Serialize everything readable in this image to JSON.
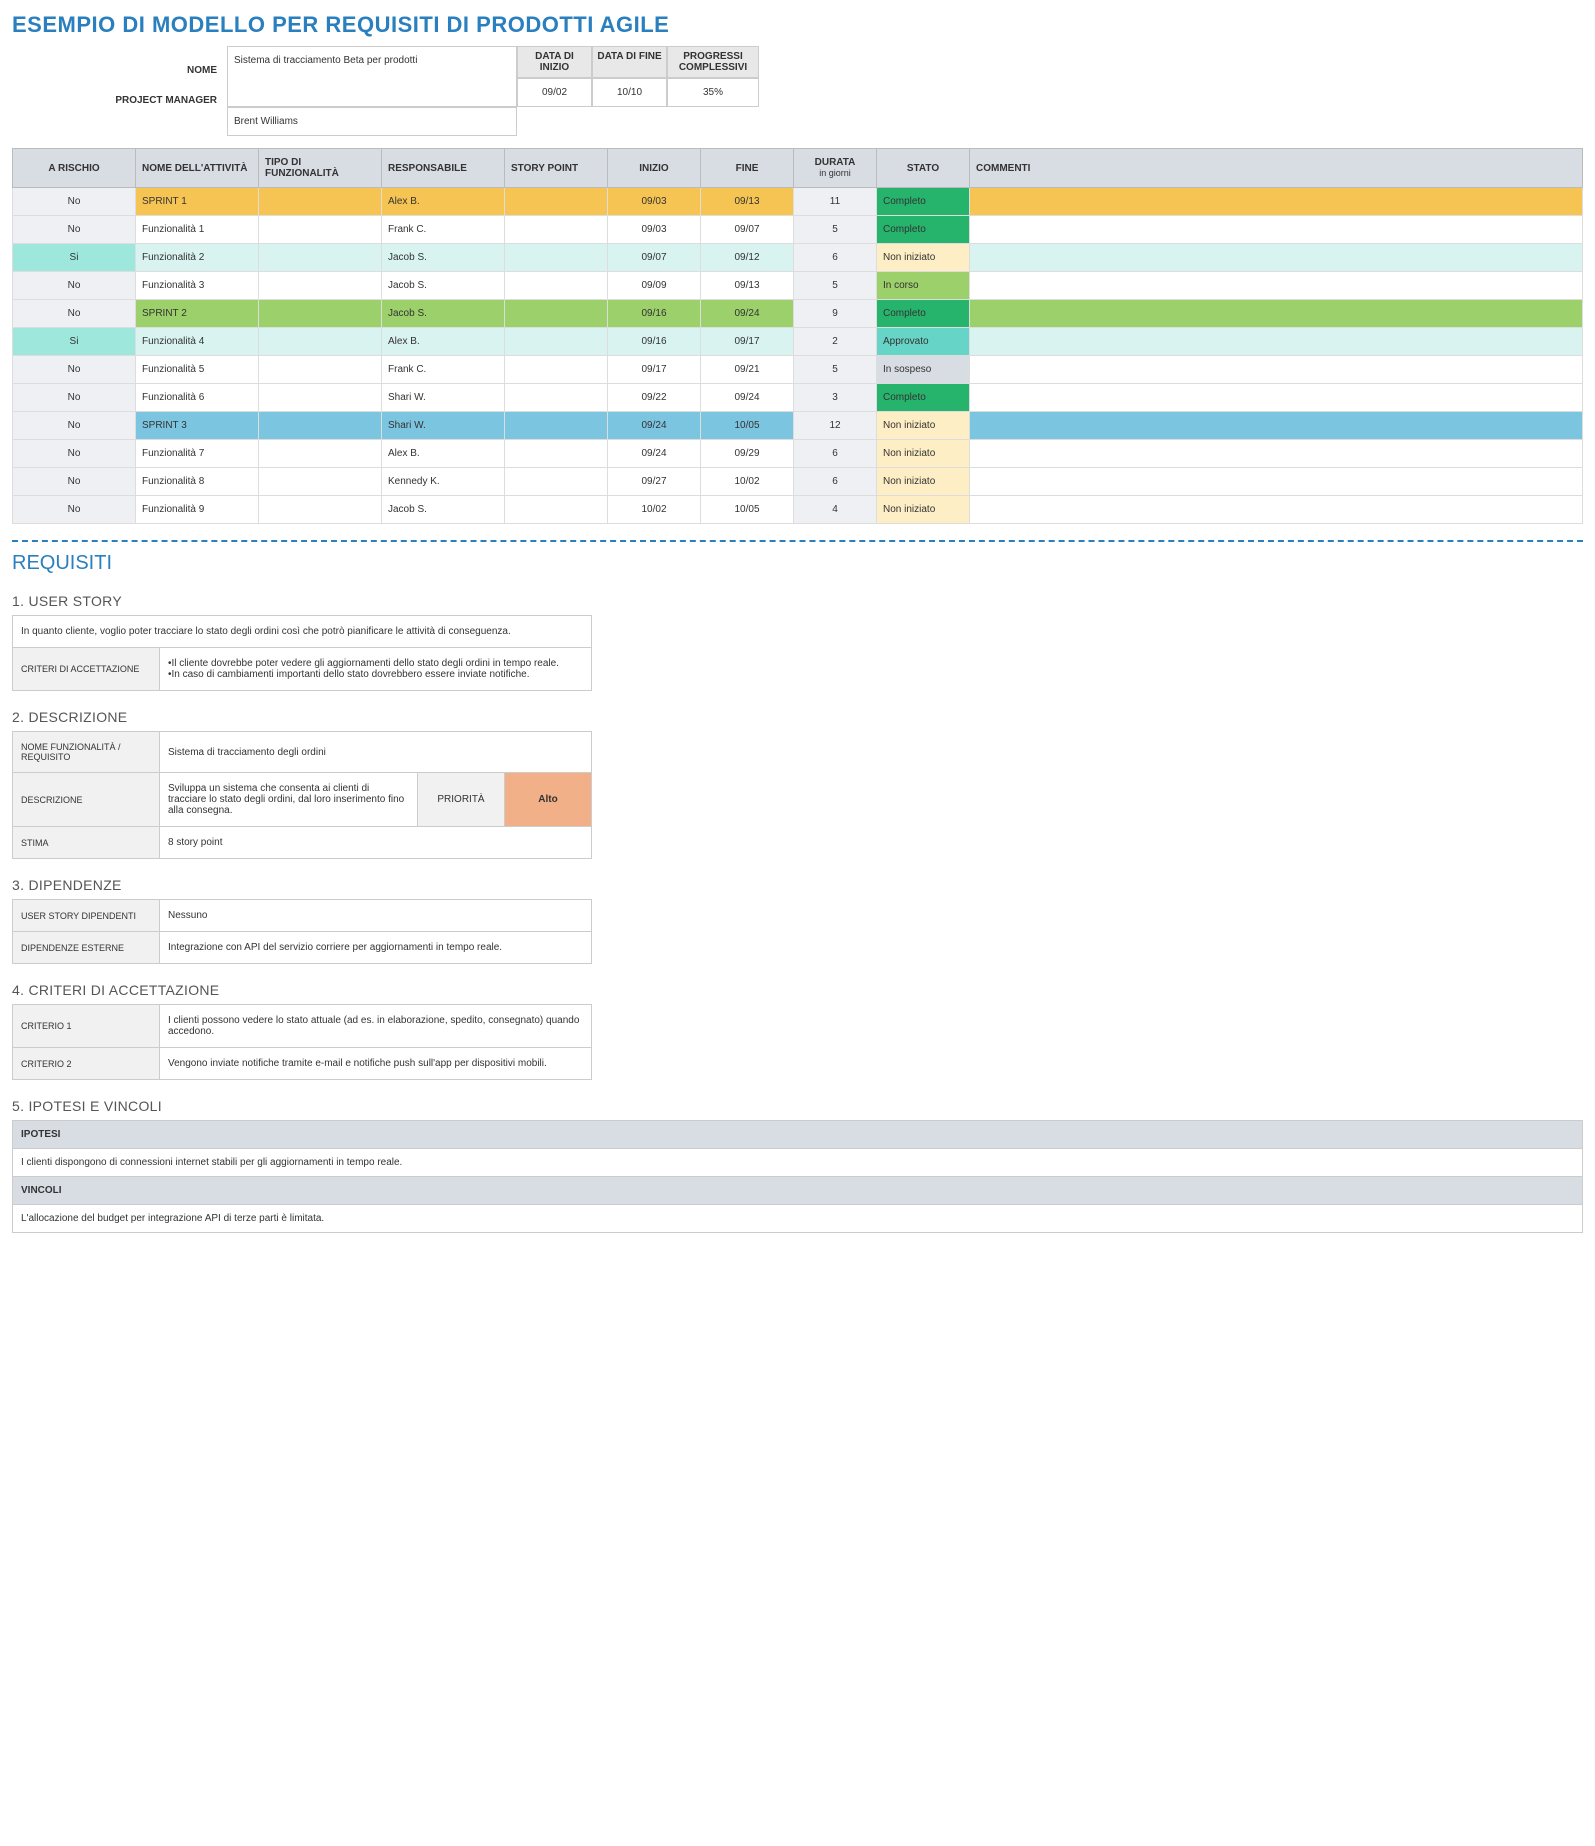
{
  "title": "ESEMPIO DI MODELLO PER REQUISITI DI PRODOTTI AGILE",
  "topLabels": {
    "nome": "NOME",
    "pm": "PROJECT MANAGER"
  },
  "topHeaders": {
    "dataInizio": "DATA DI INIZIO",
    "dataFine": "DATA DI FINE",
    "prog": "PROGRESSI COMPLESSIVI"
  },
  "project": {
    "nome": "Sistema di tracciamento Beta per prodotti",
    "pm": "Brent Williams",
    "inizio": "09/02",
    "fine": "10/10",
    "progressi": "35%"
  },
  "cols": {
    "risk": "A RISCHIO",
    "act": "NOME DELL'ATTIVITÀ",
    "type": "TIPO DI FUNZIONALITÀ",
    "resp": "RESPONSABILE",
    "sp": "STORY POINT",
    "start": "INIZIO",
    "end": "FINE",
    "dur": "DURATA",
    "durSub": "in giorni",
    "stato": "STATO",
    "comm": "COMMENTI"
  },
  "rows": [
    {
      "cls": "sprint1",
      "r": "No",
      "a": "SPRINT 1",
      "t": "",
      "resp": "Alex B.",
      "sp": "",
      "s": "09/03",
      "e": "09/13",
      "d": "11",
      "st": "Completo",
      "stc": "st-done"
    },
    {
      "cls": "",
      "r": "No",
      "a": "Funzionalità 1",
      "t": "",
      "resp": "Frank C.",
      "sp": "",
      "s": "09/03",
      "e": "09/07",
      "d": "5",
      "st": "Completo",
      "stc": "st-done"
    },
    {
      "cls": "cyan",
      "r": "Si",
      "rc": "riskcy",
      "a": "Funzionalità 2",
      "t": "",
      "resp": "Jacob S.",
      "sp": "",
      "s": "09/07",
      "e": "09/12",
      "d": "6",
      "st": "Non iniziato",
      "stc": "st-notst"
    },
    {
      "cls": "",
      "r": "No",
      "a": "Funzionalità 3",
      "t": "",
      "resp": "Jacob S.",
      "sp": "",
      "s": "09/09",
      "e": "09/13",
      "d": "5",
      "st": "In corso",
      "stc": "st-prog"
    },
    {
      "cls": "sprint2",
      "r": "No",
      "a": "SPRINT 2",
      "t": "",
      "resp": "Jacob S.",
      "sp": "",
      "s": "09/16",
      "e": "09/24",
      "d": "9",
      "st": "Completo",
      "stc": "st-done"
    },
    {
      "cls": "cyan",
      "r": "Si",
      "rc": "riskcy",
      "a": "Funzionalità 4",
      "t": "",
      "resp": "Alex B.",
      "sp": "",
      "s": "09/16",
      "e": "09/17",
      "d": "2",
      "st": "Approvato",
      "stc": "st-appr"
    },
    {
      "cls": "",
      "r": "No",
      "a": "Funzionalità 5",
      "t": "",
      "resp": "Frank C.",
      "sp": "",
      "s": "09/17",
      "e": "09/21",
      "d": "5",
      "st": "In sospeso",
      "stc": "st-hold"
    },
    {
      "cls": "",
      "r": "No",
      "a": "Funzionalità 6",
      "t": "",
      "resp": "Shari W.",
      "sp": "",
      "s": "09/22",
      "e": "09/24",
      "d": "3",
      "st": "Completo",
      "stc": "st-done"
    },
    {
      "cls": "sprint3",
      "r": "No",
      "a": "SPRINT 3",
      "t": "",
      "resp": "Shari W.",
      "sp": "",
      "s": "09/24",
      "e": "10/05",
      "d": "12",
      "st": "Non iniziato",
      "stc": "st-notst"
    },
    {
      "cls": "",
      "r": "No",
      "a": "Funzionalità 7",
      "t": "",
      "resp": "Alex B.",
      "sp": "",
      "s": "09/24",
      "e": "09/29",
      "d": "6",
      "st": "Non iniziato",
      "stc": "st-notst"
    },
    {
      "cls": "",
      "r": "No",
      "a": "Funzionalità 8",
      "t": "",
      "resp": "Kennedy K.",
      "sp": "",
      "s": "09/27",
      "e": "10/02",
      "d": "6",
      "st": "Non iniziato",
      "stc": "st-notst"
    },
    {
      "cls": "",
      "r": "No",
      "a": "Funzionalità 9",
      "t": "",
      "resp": "Jacob S.",
      "sp": "",
      "s": "10/02",
      "e": "10/05",
      "d": "4",
      "st": "Non iniziato",
      "stc": "st-notst"
    }
  ],
  "reqTitle": "REQUISITI",
  "sec1": {
    "h": "1. USER STORY",
    "story": "In quanto cliente, voglio poter tracciare lo stato degli ordini così che potrò pianificare le attività di conseguenza.",
    "critLabel": "CRITERI DI ACCETTAZIONE",
    "crit1": "•Il cliente dovrebbe poter vedere gli aggiornamenti dello stato degli ordini in tempo reale.",
    "crit2": "•In caso di cambiamenti importanti dello stato dovrebbero essere inviate notifiche."
  },
  "sec2": {
    "h": "2. DESCRIZIONE",
    "nameLabel": "NOME FUNZIONALITÀ / REQUISITO",
    "name": "Sistema di tracciamento degli ordini",
    "descLabel": "DESCRIZIONE",
    "desc": "Sviluppa un sistema che consenta ai clienti di tracciare lo stato degli ordini, dal loro inserimento fino alla consegna.",
    "priLabel": "PRIORITÀ",
    "pri": "Alto",
    "estLabel": "STIMA",
    "est": "8 story point"
  },
  "sec3": {
    "h": "3. DIPENDENZE",
    "depStoryLabel": "USER STORY DIPENDENTI",
    "depStory": "Nessuno",
    "extLabel": "DIPENDENZE ESTERNE",
    "ext": "Integrazione con API del servizio corriere per aggiornamenti in tempo reale."
  },
  "sec4": {
    "h": "4. CRITERI DI ACCETTAZIONE",
    "c1l": "CRITERIO 1",
    "c1": "I clienti possono vedere lo stato attuale (ad es. in elaborazione, spedito, consegnato) quando accedono.",
    "c2l": "CRITERIO 2",
    "c2": "Vengono inviate notifiche tramite e-mail e notifiche push sull'app per dispositivi mobili."
  },
  "sec5": {
    "h": "5. IPOTESI E VINCOLI",
    "hypH": "IPOTESI",
    "hyp": "I clienti dispongono di connessioni internet stabili per gli aggiornamenti in tempo reale.",
    "conH": "VINCOLI",
    "con": "L'allocazione del budget per integrazione API di terze parti è limitata."
  }
}
